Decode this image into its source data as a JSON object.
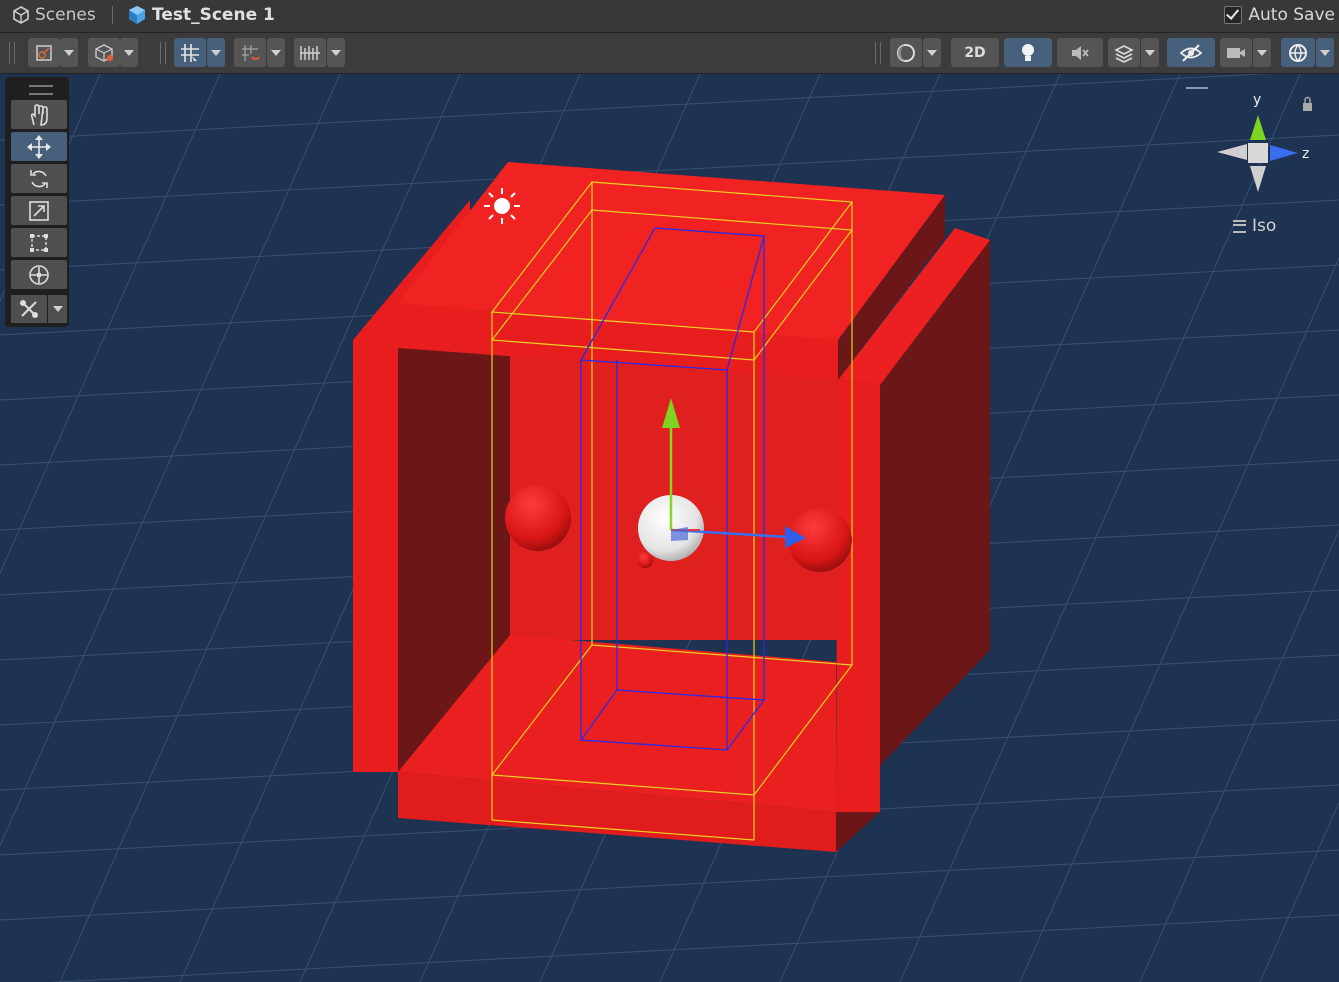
{
  "titlebar": {
    "scenes_label": "Scenes",
    "scene_name": "Test_Scene 1",
    "autosave_label": "Auto Save",
    "autosave_checked": true
  },
  "toolbar": {
    "left_icons": [
      "draw-mode-icon",
      "render-paths-icon",
      "grid-snap-icon",
      "increment-snap-icon",
      "grid-visibility-icon"
    ],
    "right_icons": [
      "shading-mode-icon",
      "2d-toggle",
      "lighting-icon",
      "audio-mute-icon",
      "effects-icon",
      "scene-visibility-icon",
      "camera-icon",
      "gizmos-icon"
    ],
    "mode_2d_label": "2D"
  },
  "tools": {
    "items": [
      "hand-tool",
      "move-tool",
      "rotate-tool",
      "scale-tool",
      "rect-tool",
      "transform-tool"
    ],
    "active": "move-tool",
    "custom": "custom-tool"
  },
  "orientation_gizmo": {
    "axis_y": "y",
    "axis_z": "z",
    "projection_label": "Iso",
    "axis_colors": {
      "y": "#7dd31f",
      "x": "#e03a3a",
      "z": "#3a6ef0"
    }
  },
  "colors": {
    "background": "#1e3252",
    "object": "#e81e1e",
    "object_shadow": "#6c1717",
    "accent_active": "#46607c"
  }
}
